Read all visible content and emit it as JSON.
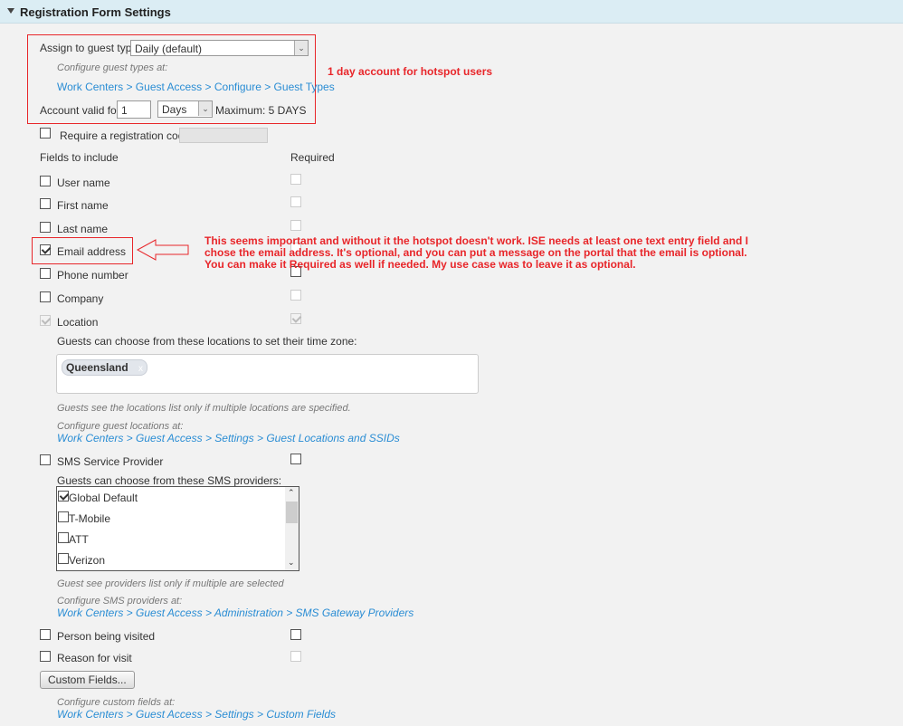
{
  "section": {
    "title": "Registration Form Settings"
  },
  "guest_type": {
    "label": "Assign to guest type",
    "value": "Daily (default)",
    "hint": "Configure guest types at:",
    "link": "Work Centers > Guest Access > Configure > Guest Types"
  },
  "validity": {
    "label": "Account valid for:",
    "value": "1",
    "unit": "Days",
    "max": "Maximum: 5 DAYS"
  },
  "reg_code": {
    "label": "Require a registration code",
    "checked": false
  },
  "fields_header": "Fields to include",
  "required_header": "Required",
  "fields": [
    {
      "label": "User name",
      "checked": false,
      "required": false
    },
    {
      "label": "First name",
      "checked": false,
      "required": false
    },
    {
      "label": "Last name",
      "checked": false,
      "required": false
    },
    {
      "label": "Email address",
      "checked": true,
      "required": false
    },
    {
      "label": "Phone number",
      "checked": false,
      "required": false
    },
    {
      "label": "Company",
      "checked": false,
      "required": false
    },
    {
      "label": "Location",
      "checked": true,
      "required": true
    }
  ],
  "locations": {
    "label": "Guests can choose from these locations to set their time zone:",
    "tags": [
      "Queensland"
    ],
    "tag_remove": "x",
    "note": "Guests see the locations list only if multiple locations are specified.",
    "hint": "Configure guest locations at:",
    "link": "Work Centers > Guest Access > Settings > Guest Locations and SSIDs"
  },
  "sms": {
    "label": "SMS Service Provider",
    "providers_label": "Guests can choose from these SMS providers:",
    "providers": [
      {
        "label": "Global Default",
        "checked": true
      },
      {
        "label": "T-Mobile",
        "checked": false
      },
      {
        "label": "ATT",
        "checked": false
      },
      {
        "label": "Verizon",
        "checked": false
      }
    ],
    "note": "Guest see providers list only if multiple are selected",
    "hint": "Configure SMS providers at:",
    "link": "Work Centers > Guest Access > Administration > SMS Gateway Providers"
  },
  "person_visited": {
    "label": "Person being visited"
  },
  "reason": {
    "label": "Reason for visit"
  },
  "custom": {
    "button": "Custom Fields...",
    "hint": "Configure custom fields at:",
    "link": "Work Centers > Guest Access > Settings > Custom Fields"
  },
  "annotations": {
    "one_day": "1 day account for hotspot users",
    "email": [
      "This seems important and without it the hotspot doesn't work.  ISE needs at least one text entry field and I",
      "chose the email address.  It's optional, and you can put a message on the portal that the email is optional.",
      "You can make it Required as well if needed.  My use case was to leave it as optional."
    ]
  },
  "colors": {
    "annotation": "#e8262a",
    "link": "#2a8dd4",
    "header_bg": "#dbedf4"
  }
}
